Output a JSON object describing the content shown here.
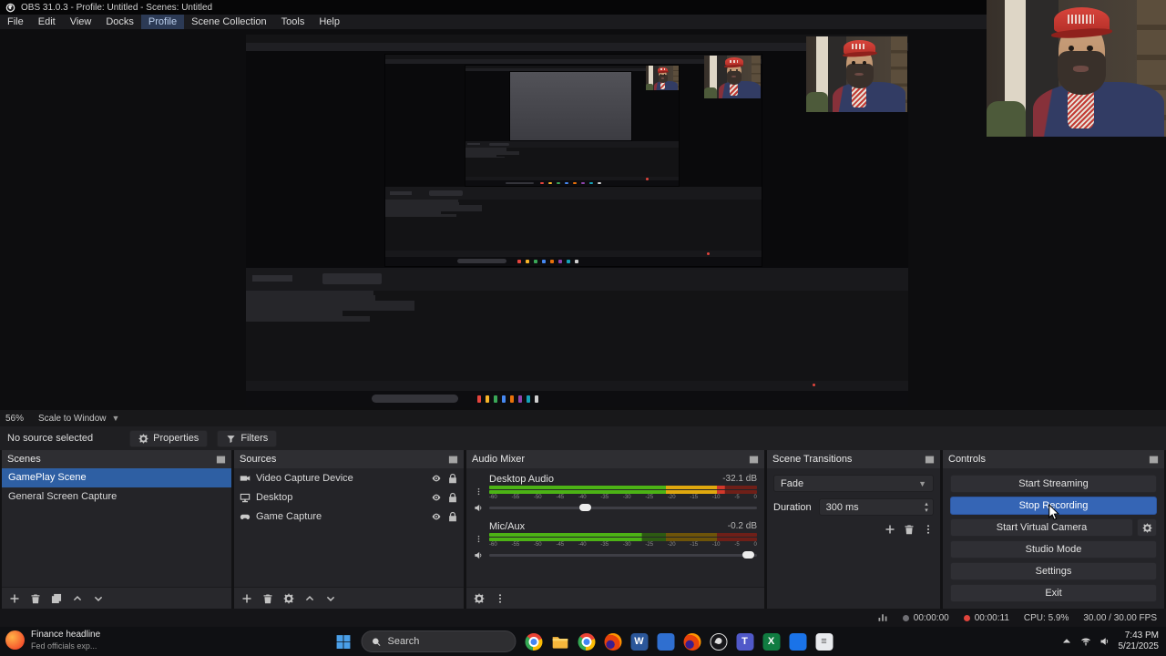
{
  "window": {
    "title": "OBS 31.0.3 - Profile: Untitled - Scenes: Untitled",
    "menu_items": [
      "File",
      "Edit",
      "View",
      "Docks",
      "Profile",
      "Scene Collection",
      "Tools",
      "Help"
    ],
    "highlighted_menu": "Profile"
  },
  "preview_bar": {
    "zoom": "56%",
    "scale_mode": "Scale to Window"
  },
  "source_toolbar": {
    "status": "No source selected",
    "properties_label": "Properties",
    "filters_label": "Filters"
  },
  "panels": {
    "scenes": {
      "title": "Scenes",
      "items": [
        {
          "label": "GamePlay Scene",
          "selected": true
        },
        {
          "label": "General Screen Capture",
          "selected": false
        }
      ]
    },
    "sources": {
      "title": "Sources",
      "items": [
        {
          "label": "Video Capture Device",
          "icon": "videocam"
        },
        {
          "label": "Desktop",
          "icon": "monitor"
        },
        {
          "label": "Game Capture",
          "icon": "gamepad"
        }
      ]
    },
    "audio_mixer": {
      "title": "Audio Mixer",
      "channels": [
        {
          "name": "Desktop Audio",
          "level_db": "-32.1 dB",
          "meter_pct": 88,
          "volume_pct": 36
        },
        {
          "name": "Mic/Aux",
          "level_db": "-0.2 dB",
          "meter_pct": 57,
          "volume_pct": 97
        }
      ],
      "scale_ticks": [
        "-60",
        "-55",
        "-50",
        "-45",
        "-40",
        "-35",
        "-30",
        "-25",
        "-20",
        "-15",
        "-10",
        "-5",
        "0"
      ]
    },
    "scene_transitions": {
      "title": "Scene Transitions",
      "transition": "Fade",
      "duration_label": "Duration",
      "duration_value": "300 ms"
    },
    "controls": {
      "title": "Controls",
      "buttons": [
        {
          "label": "Start Streaming",
          "active": false,
          "gear": false
        },
        {
          "label": "Stop Recording",
          "active": true,
          "gear": false
        },
        {
          "label": "Start Virtual Camera",
          "active": false,
          "gear": true
        },
        {
          "label": "Studio Mode",
          "active": false,
          "gear": false
        },
        {
          "label": "Settings",
          "active": false,
          "gear": false
        },
        {
          "label": "Exit",
          "active": false,
          "gear": false
        }
      ]
    }
  },
  "status_bar": {
    "stream_time": "00:00:00",
    "recording_time": "00:00:11",
    "cpu": "CPU: 5.9%",
    "fps": "30.00 / 30.00 FPS"
  },
  "taskbar": {
    "widget": {
      "title": "Finance headline",
      "subtitle": "Fed officials exp..."
    },
    "search_placeholder": "Search",
    "apps": [
      {
        "name": "chrome-icon",
        "kind": "chrome"
      },
      {
        "name": "file-explorer-icon",
        "kind": "folder"
      },
      {
        "name": "chrome-profile-icon",
        "kind": "chrome"
      },
      {
        "name": "firefox-icon",
        "kind": "firefox"
      },
      {
        "name": "word-icon",
        "kind": "square",
        "bg": "#2b579a",
        "letter": "W"
      },
      {
        "name": "app-blue-icon",
        "kind": "square",
        "bg": "#2f6fd0",
        "letter": ""
      },
      {
        "name": "firefox-icon-2",
        "kind": "firefox"
      },
      {
        "name": "obs-icon",
        "kind": "obs"
      },
      {
        "name": "teams-icon",
        "kind": "square",
        "bg": "#5059c9",
        "letter": "T"
      },
      {
        "name": "excel-icon",
        "kind": "square",
        "bg": "#107c41",
        "letter": "X"
      },
      {
        "name": "grid-app-icon",
        "kind": "square",
        "bg": "#1a73e8",
        "letter": ""
      },
      {
        "name": "notepad-icon",
        "kind": "square",
        "bg": "#e8eaed",
        "letter": "≡",
        "fg": "#555555"
      }
    ],
    "clock": {
      "time": "7:43 PM",
      "date": "5/21/2025"
    }
  },
  "colors": {
    "accent_blue": "#3565b5",
    "selection_blue": "#2e5fa3",
    "meter_green": "#4cb315",
    "meter_yellow": "#e0a80e",
    "meter_red": "#d3382a",
    "record_red": "#e0443c"
  }
}
